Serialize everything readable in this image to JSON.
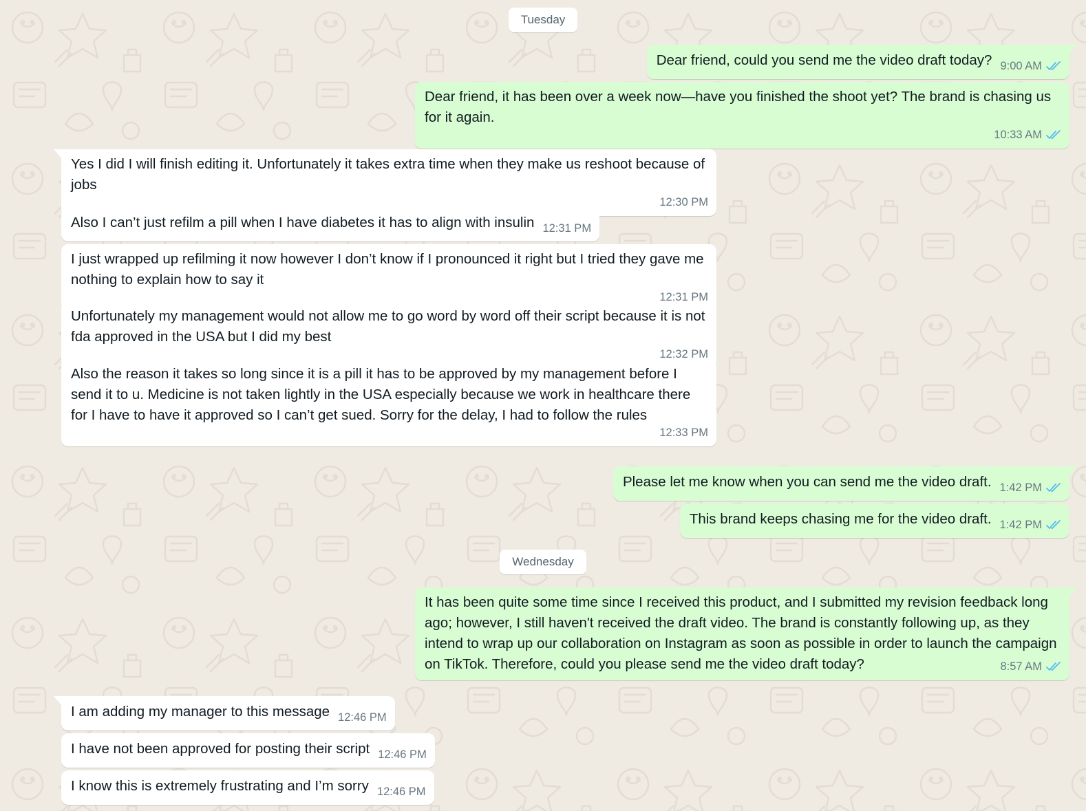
{
  "colors": {
    "background": "#efeae2",
    "outgoing_bubble": "#d9fdd3",
    "incoming_bubble": "#ffffff",
    "read_receipt": "#53bdeb",
    "timestamp": "#667781"
  },
  "days": {
    "tuesday": "Tuesday",
    "wednesday": "Wednesday"
  },
  "messages": [
    {
      "dir": "out",
      "text": "Dear friend, could you send me the video draft today?",
      "time": "9:00 AM",
      "status_icon": "double-check-read-icon"
    },
    {
      "dir": "out",
      "text": "Dear friend, it has been over a week now—have you finished the shoot yet? The brand is chasing us for it again.",
      "time": "10:33 AM",
      "status_icon": "double-check-read-icon"
    },
    {
      "dir": "in",
      "text": "Yes I did I will finish editing it. Unfortunately it takes extra time when they make us reshoot because of jobs",
      "time": "12:30 PM"
    },
    {
      "dir": "in",
      "text": "Also I can’t just refilm a pill when I have diabetes it has to align with insulin",
      "time": "12:31 PM"
    },
    {
      "dir": "in",
      "text": "I just wrapped up refilming it now however I don’t know if I pronounced it right but I tried they gave me nothing to explain how to say it",
      "time": "12:31 PM"
    },
    {
      "dir": "in",
      "text": "Unfortunately my management would not allow me to go word by word off their script because it is not fda approved in the USA but I did my best",
      "time": "12:32 PM"
    },
    {
      "dir": "in",
      "text": "Also the reason it takes so long since it is a pill it has to be approved by my management before I send it to u. Medicine is not taken lightly in the USA especially because we work in healthcare there for I have to have it approved so I can’t get sued. Sorry for the delay, I had to follow the rules",
      "time": "12:33 PM"
    },
    {
      "dir": "out",
      "text": "Please let me know when you can send me the video draft.",
      "time": "1:42 PM",
      "status_icon": "double-check-read-icon"
    },
    {
      "dir": "out",
      "text": "This brand keeps chasing me for the video draft.",
      "time": "1:42 PM",
      "status_icon": "double-check-read-icon"
    },
    {
      "dir": "out",
      "text": "It has been quite some time since I received this product, and I submitted my revision feedback long ago; however, I still haven't received the draft video. The brand is constantly following up, as they intend to wrap up our collaboration on Instagram as soon as possible in order to launch the campaign on TikTok. Therefore, could you please send me the video draft today?",
      "time": "8:57 AM",
      "status_icon": "double-check-read-icon"
    },
    {
      "dir": "in",
      "text": "I am adding my manager to this message",
      "time": "12:46 PM"
    },
    {
      "dir": "in",
      "text": "I have not been approved for posting their script",
      "time": "12:46 PM"
    },
    {
      "dir": "in",
      "text": "I know this is extremely frustrating and I’m sorry",
      "time": "12:46 PM"
    }
  ]
}
